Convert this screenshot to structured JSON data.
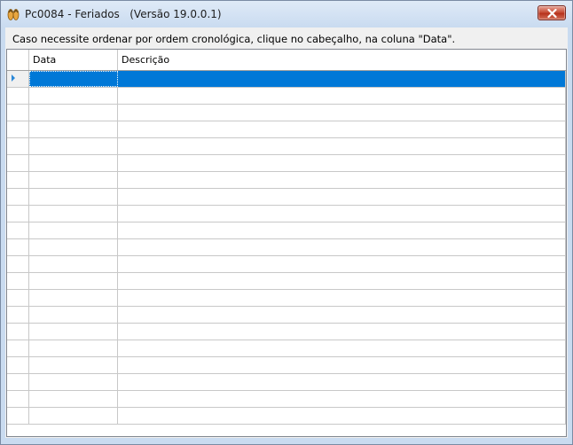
{
  "window": {
    "title": "Pc0084 - Feriados   (Versão 19.0.0.1)",
    "icon": "flip-flops-icon",
    "close_icon": "close-icon"
  },
  "info": {
    "text": "Caso necessite ordenar por ordem cronológica, clique no cabeçalho, na coluna \"Data\"."
  },
  "grid": {
    "columns": [
      "Data",
      "Descrição"
    ],
    "row_count": 21,
    "selected_row": 0,
    "rows": [],
    "selection_color": "#0078d7"
  }
}
